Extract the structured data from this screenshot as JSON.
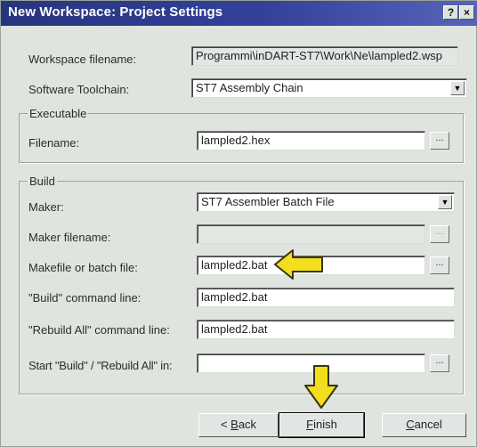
{
  "window": {
    "title": "New Workspace: Project Settings",
    "help_btn": "?",
    "close_btn": "×"
  },
  "workspace": {
    "filename_label": "Workspace filename:",
    "filename_value": "Programmi\\inDART-ST7\\Work\\Ne\\lampled2.wsp",
    "toolchain_label": "Software Toolchain:",
    "toolchain_value": "ST7 Assembly Chain"
  },
  "executable": {
    "group_title": "Executable",
    "filename_label": "Filename:",
    "filename_value": "lampled2.hex",
    "browse_label": "..."
  },
  "build": {
    "group_title": "Build",
    "maker_label": "Maker:",
    "maker_value": "ST7 Assembler Batch File",
    "maker_filename_label": "Maker filename:",
    "maker_filename_value": "",
    "makefile_label": "Makefile or batch file:",
    "makefile_value": "lampled2.bat",
    "build_cmd_label": "\"Build\" command line:",
    "build_cmd_value": "lampled2.bat",
    "rebuild_cmd_label": "\"Rebuild All\" command line:",
    "rebuild_cmd_value": "lampled2.bat",
    "start_in_label": "Start \"Build\" / \"Rebuild All\" in:",
    "start_in_value": "",
    "browse_label": "..."
  },
  "buttons": {
    "back_prefix": "< ",
    "back_u": "B",
    "back_rest": "ack",
    "finish_u": "F",
    "finish_rest": "inish",
    "cancel_u": "C",
    "cancel_rest": "ancel"
  },
  "colors": {
    "titlebar": "#27357e",
    "dialog_bg": "#dfe4df",
    "arrow_fill": "#f2de1e",
    "arrow_outline": "#3a3412"
  }
}
